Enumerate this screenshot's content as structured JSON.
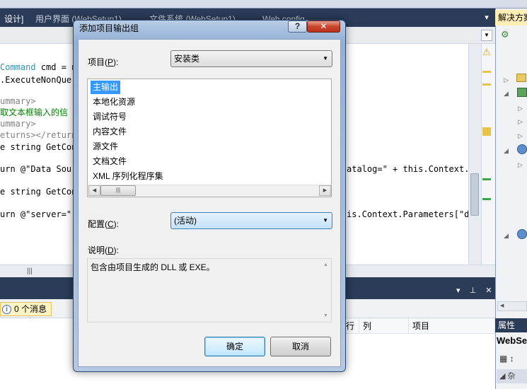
{
  "ide": {
    "tabs": [
      {
        "label": "设计]"
      },
      {
        "label": "用户界面 (WebSetup1)"
      },
      {
        "label": "文件系统 (WebSetup1)"
      },
      {
        "label": "Web.config"
      }
    ],
    "tab_close": "▾",
    "code_lines": [
      {
        "plain": "Command",
        "rest": " cmd = n"
      },
      {
        "plain": "",
        "rest": ".ExecuteNonQuer"
      },
      {
        "plain": "",
        "rest": "ummary>"
      },
      {
        "plain": "",
        "rest": "取文本框输入的信"
      },
      {
        "plain": "",
        "rest": "ummary>"
      },
      {
        "plain": "",
        "rest": "eturns></returns"
      },
      {
        "plain": "",
        "rest": "e string GetConn"
      },
      {
        "plain": "",
        "rest": "urn @\"Data Sour"
      },
      {
        "plain": "",
        "rest": "e string GetConn"
      },
      {
        "plain": "",
        "rest": "urn @\"server=\""
      }
    ],
    "code_right_1": "atalog=\" + this.Context.P",
    "code_right_2": "is.Context.Parameters[\"dl",
    "output": {
      "message_count": "0 个消息",
      "columns": [
        "行",
        "列",
        "项目"
      ]
    },
    "solution_title": "解决方案",
    "properties_title": "属性",
    "properties_object": "WebSe"
  },
  "dialog": {
    "title": "添加项目输出组",
    "help_button": "?",
    "close_button": "✕",
    "project_label": "项目(",
    "project_hotkey": "P",
    "project_label_end": "):",
    "project_value": "安装类",
    "list_items": [
      "主输出",
      "本地化资源",
      "调试符号",
      "内容文件",
      "源文件",
      "文档文件",
      "XML 序列化程序集"
    ],
    "selected_item": "主输出",
    "config_label": "配置(",
    "config_hotkey": "C",
    "config_label_end": "):",
    "config_value": "(活动)",
    "description_label": "说明(",
    "description_hotkey": "D",
    "description_label_end": "):",
    "description_text": "包含由项目生成的 DLL 或 EXE。",
    "ok_button": "确定",
    "cancel_button": "取消"
  }
}
